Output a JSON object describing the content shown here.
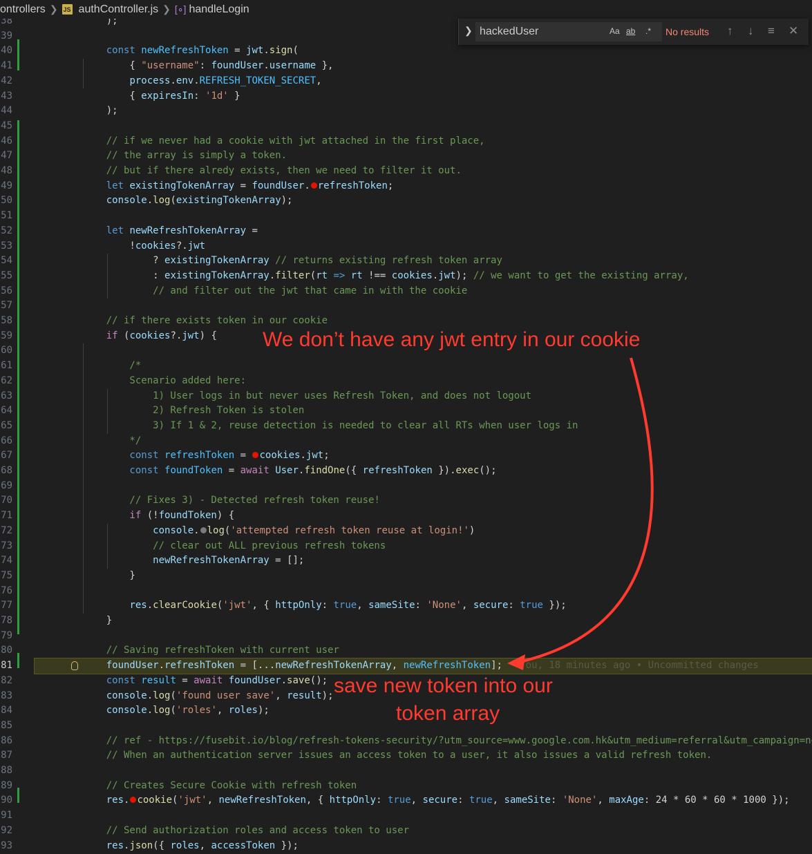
{
  "breadcrumb": {
    "folder": "ontrollers",
    "file": "authController.js",
    "file_icon_label": "JS",
    "symbol": "handleLogin"
  },
  "find_widget": {
    "query": "hackedUser",
    "match_case_label": "Aa",
    "whole_word_label": "ab",
    "regex_label": ".*",
    "status": "No results"
  },
  "editor": {
    "blame": "You, 18 minutes ago • Uncommitted changes",
    "lines": [
      {
        "n": "38",
        "tokens": [
          [
            "plain",
            "    );"
          ]
        ]
      },
      {
        "n": "39",
        "tokens": []
      },
      {
        "n": "40",
        "tokens": [
          [
            "kw",
            "    const "
          ],
          [
            "const",
            "newRefreshToken"
          ],
          [
            "plain",
            " = "
          ],
          [
            "var",
            "jwt"
          ],
          [
            "plain",
            "."
          ],
          [
            "fn",
            "sign"
          ],
          [
            "plain",
            "("
          ]
        ]
      },
      {
        "n": "41",
        "tokens": [
          [
            "plain",
            "        { "
          ],
          [
            "str",
            "\"username\""
          ],
          [
            "plain",
            ": "
          ],
          [
            "var",
            "foundUser"
          ],
          [
            "plain",
            "."
          ],
          [
            "var",
            "username"
          ],
          [
            "plain",
            " },"
          ]
        ]
      },
      {
        "n": "42",
        "tokens": [
          [
            "plain",
            "        "
          ],
          [
            "var",
            "process"
          ],
          [
            "plain",
            "."
          ],
          [
            "var",
            "env"
          ],
          [
            "plain",
            "."
          ],
          [
            "const",
            "REFRESH_TOKEN_SECRET"
          ],
          [
            "plain",
            ","
          ]
        ]
      },
      {
        "n": "43",
        "tokens": [
          [
            "plain",
            "        { "
          ],
          [
            "var",
            "expiresIn"
          ],
          [
            "plain",
            ": "
          ],
          [
            "str",
            "'1d'"
          ],
          [
            "plain",
            " }"
          ]
        ]
      },
      {
        "n": "44",
        "tokens": [
          [
            "plain",
            "    );"
          ]
        ]
      },
      {
        "n": "45",
        "tokens": []
      },
      {
        "n": "46",
        "tokens": [
          [
            "cm",
            "    // if we never had a cookie with jwt attached in the first place,"
          ]
        ]
      },
      {
        "n": "47",
        "tokens": [
          [
            "cm",
            "    // the array is simply a token."
          ]
        ]
      },
      {
        "n": "48",
        "tokens": [
          [
            "cm",
            "    // but if there alredy exists, then we need to filter it out."
          ]
        ]
      },
      {
        "n": "49",
        "tokens": [
          [
            "kw",
            "    let "
          ],
          [
            "var",
            "existingTokenArray"
          ],
          [
            "plain",
            " = "
          ],
          [
            "var",
            "foundUser"
          ],
          [
            "plain",
            "."
          ],
          [
            "bp",
            ""
          ],
          [
            "var",
            "refreshToken"
          ],
          [
            "plain",
            ";"
          ]
        ]
      },
      {
        "n": "50",
        "tokens": [
          [
            "plain",
            "    "
          ],
          [
            "var",
            "console"
          ],
          [
            "plain",
            "."
          ],
          [
            "fn",
            "log"
          ],
          [
            "plain",
            "("
          ],
          [
            "var",
            "existingTokenArray"
          ],
          [
            "plain",
            ");"
          ]
        ]
      },
      {
        "n": "51",
        "tokens": []
      },
      {
        "n": "52",
        "tokens": [
          [
            "kw",
            "    let "
          ],
          [
            "var",
            "newRefreshTokenArray"
          ],
          [
            "plain",
            " ="
          ]
        ]
      },
      {
        "n": "53",
        "tokens": [
          [
            "plain",
            "        !"
          ],
          [
            "var",
            "cookies"
          ],
          [
            "plain",
            "?."
          ],
          [
            "var",
            "jwt"
          ]
        ]
      },
      {
        "n": "54",
        "tokens": [
          [
            "plain",
            "            ? "
          ],
          [
            "var",
            "existingTokenArray"
          ],
          [
            "cm",
            " // returns existing refresh token array"
          ]
        ]
      },
      {
        "n": "55",
        "tokens": [
          [
            "plain",
            "            : "
          ],
          [
            "var",
            "existingTokenArray"
          ],
          [
            "plain",
            "."
          ],
          [
            "fn",
            "filter"
          ],
          [
            "plain",
            "("
          ],
          [
            "var",
            "rt"
          ],
          [
            "kw",
            " => "
          ],
          [
            "var",
            "rt"
          ],
          [
            "plain",
            " !== "
          ],
          [
            "var",
            "cookies"
          ],
          [
            "plain",
            "."
          ],
          [
            "var",
            "jwt"
          ],
          [
            "plain",
            ");"
          ],
          [
            "cm",
            " // we want to get the existing array,"
          ]
        ]
      },
      {
        "n": "56",
        "tokens": [
          [
            "cm",
            "            // and filter out the jwt that came in with the cookie"
          ]
        ]
      },
      {
        "n": "57",
        "tokens": []
      },
      {
        "n": "58",
        "tokens": [
          [
            "cm",
            "    // if there exists token in our cookie"
          ]
        ]
      },
      {
        "n": "59",
        "tokens": [
          [
            "ctl",
            "    if "
          ],
          [
            "plain",
            "("
          ],
          [
            "var",
            "cookies"
          ],
          [
            "plain",
            "?."
          ],
          [
            "var",
            "jwt"
          ],
          [
            "plain",
            ") {"
          ]
        ]
      },
      {
        "n": "60",
        "tokens": []
      },
      {
        "n": "61",
        "tokens": [
          [
            "cm",
            "        /*"
          ]
        ]
      },
      {
        "n": "62",
        "tokens": [
          [
            "cm",
            "        Scenario added here:"
          ]
        ]
      },
      {
        "n": "63",
        "tokens": [
          [
            "cm",
            "            1) User logs in but never uses Refresh Token, and does not logout"
          ]
        ]
      },
      {
        "n": "64",
        "tokens": [
          [
            "cm",
            "            2) Refresh Token is stolen"
          ]
        ]
      },
      {
        "n": "65",
        "tokens": [
          [
            "cm",
            "            3) If 1 & 2, reuse detection is needed to clear all RTs when user logs in"
          ]
        ]
      },
      {
        "n": "66",
        "tokens": [
          [
            "cm",
            "        */"
          ]
        ]
      },
      {
        "n": "67",
        "tokens": [
          [
            "kw",
            "        const "
          ],
          [
            "const",
            "refreshToken"
          ],
          [
            "plain",
            " = "
          ],
          [
            "bp",
            ""
          ],
          [
            "var",
            "cookies"
          ],
          [
            "plain",
            "."
          ],
          [
            "var",
            "jwt"
          ],
          [
            "plain",
            ";"
          ]
        ]
      },
      {
        "n": "68",
        "tokens": [
          [
            "kw",
            "        const "
          ],
          [
            "const",
            "foundToken"
          ],
          [
            "plain",
            " = "
          ],
          [
            "ctl",
            "await "
          ],
          [
            "var",
            "User"
          ],
          [
            "plain",
            "."
          ],
          [
            "fn",
            "findOne"
          ],
          [
            "plain",
            "({ "
          ],
          [
            "var",
            "refreshToken"
          ],
          [
            "plain",
            " })."
          ],
          [
            "fn",
            "exec"
          ],
          [
            "plain",
            "();"
          ]
        ]
      },
      {
        "n": "69",
        "tokens": []
      },
      {
        "n": "70",
        "tokens": [
          [
            "cm",
            "        // Fixes 3) - Detected refresh token reuse!"
          ]
        ]
      },
      {
        "n": "71",
        "tokens": [
          [
            "ctl",
            "        if "
          ],
          [
            "plain",
            "(!"
          ],
          [
            "var",
            "foundToken"
          ],
          [
            "plain",
            ") {"
          ]
        ]
      },
      {
        "n": "72",
        "tokens": [
          [
            "plain",
            "            "
          ],
          [
            "var",
            "console"
          ],
          [
            "plain",
            "."
          ],
          [
            "bpg",
            ""
          ],
          [
            "fn",
            "log"
          ],
          [
            "plain",
            "("
          ],
          [
            "str",
            "'attempted refresh token reuse at login!'"
          ],
          [
            "plain",
            ")"
          ]
        ]
      },
      {
        "n": "73",
        "tokens": [
          [
            "cm",
            "            // clear out ALL previous refresh tokens"
          ]
        ]
      },
      {
        "n": "74",
        "tokens": [
          [
            "plain",
            "            "
          ],
          [
            "var",
            "newRefreshTokenArray"
          ],
          [
            "plain",
            " = [];"
          ]
        ]
      },
      {
        "n": "75",
        "tokens": [
          [
            "plain",
            "        }"
          ]
        ]
      },
      {
        "n": "76",
        "tokens": []
      },
      {
        "n": "77",
        "tokens": [
          [
            "plain",
            "        "
          ],
          [
            "var",
            "res"
          ],
          [
            "plain",
            "."
          ],
          [
            "fn",
            "clearCookie"
          ],
          [
            "plain",
            "("
          ],
          [
            "str",
            "'jwt'"
          ],
          [
            "plain",
            ", { "
          ],
          [
            "var",
            "httpOnly"
          ],
          [
            "plain",
            ": "
          ],
          [
            "kw",
            "true"
          ],
          [
            "plain",
            ", "
          ],
          [
            "var",
            "sameSite"
          ],
          [
            "plain",
            ": "
          ],
          [
            "str",
            "'None'"
          ],
          [
            "plain",
            ", "
          ],
          [
            "var",
            "secure"
          ],
          [
            "plain",
            ": "
          ],
          [
            "kw",
            "true"
          ],
          [
            "plain",
            " });"
          ]
        ]
      },
      {
        "n": "78",
        "tokens": [
          [
            "plain",
            "    }"
          ]
        ]
      },
      {
        "n": "79",
        "tokens": []
      },
      {
        "n": "80",
        "tokens": [
          [
            "cm",
            "    // Saving refreshToken with current user"
          ]
        ]
      },
      {
        "n": "81",
        "tokens": [
          [
            "plain",
            "    "
          ],
          [
            "var",
            "foundUser"
          ],
          [
            "plain",
            "."
          ],
          [
            "var",
            "refreshToken"
          ],
          [
            "plain",
            " = [..."
          ],
          [
            "var",
            "newRefreshTokenArray"
          ],
          [
            "plain",
            ", "
          ],
          [
            "const",
            "newRefreshToken"
          ],
          [
            "plain",
            "];"
          ]
        ]
      },
      {
        "n": "82",
        "tokens": [
          [
            "kw",
            "    const "
          ],
          [
            "const",
            "result"
          ],
          [
            "plain",
            " = "
          ],
          [
            "ctl",
            "await "
          ],
          [
            "var",
            "foundUser"
          ],
          [
            "plain",
            "."
          ],
          [
            "fn",
            "save"
          ],
          [
            "plain",
            "();"
          ]
        ]
      },
      {
        "n": "83",
        "tokens": [
          [
            "plain",
            "    "
          ],
          [
            "var",
            "console"
          ],
          [
            "plain",
            "."
          ],
          [
            "fn",
            "log"
          ],
          [
            "plain",
            "("
          ],
          [
            "str",
            "'found user save'"
          ],
          [
            "plain",
            ", "
          ],
          [
            "var",
            "result"
          ],
          [
            "plain",
            ");"
          ]
        ]
      },
      {
        "n": "84",
        "tokens": [
          [
            "plain",
            "    "
          ],
          [
            "var",
            "console"
          ],
          [
            "plain",
            "."
          ],
          [
            "fn",
            "log"
          ],
          [
            "plain",
            "("
          ],
          [
            "str",
            "'roles'"
          ],
          [
            "plain",
            ", "
          ],
          [
            "var",
            "roles"
          ],
          [
            "plain",
            ");"
          ]
        ]
      },
      {
        "n": "85",
        "tokens": []
      },
      {
        "n": "86",
        "tokens": [
          [
            "cm",
            "    // ref - https://fusebit.io/blog/refresh-tokens-security/?utm_source=www.google.com.hk&utm_medium=referral&utm_campaign=no"
          ]
        ]
      },
      {
        "n": "87",
        "tokens": [
          [
            "cm",
            "    // When an authentication server issues an access token to a user, it also issues a valid refresh token."
          ]
        ]
      },
      {
        "n": "88",
        "tokens": []
      },
      {
        "n": "89",
        "tokens": [
          [
            "cm",
            "    // Creates Secure Cookie with refresh token"
          ]
        ]
      },
      {
        "n": "90",
        "tokens": [
          [
            "plain",
            "    "
          ],
          [
            "var",
            "res"
          ],
          [
            "plain",
            "."
          ],
          [
            "bp",
            ""
          ],
          [
            "fn",
            "cookie"
          ],
          [
            "plain",
            "("
          ],
          [
            "str",
            "'jwt'"
          ],
          [
            "plain",
            ", "
          ],
          [
            "var",
            "newRefreshToken"
          ],
          [
            "plain",
            ", { "
          ],
          [
            "var",
            "httpOnly"
          ],
          [
            "plain",
            ": "
          ],
          [
            "kw",
            "true"
          ],
          [
            "plain",
            ", "
          ],
          [
            "var",
            "secure"
          ],
          [
            "plain",
            ": "
          ],
          [
            "kw",
            "true"
          ],
          [
            "plain",
            ", "
          ],
          [
            "var",
            "sameSite"
          ],
          [
            "plain",
            ": "
          ],
          [
            "str",
            "'None'"
          ],
          [
            "plain",
            ", "
          ],
          [
            "var",
            "maxAge"
          ],
          [
            "plain",
            ": 24 * 60 * 60 * 1000 });"
          ]
        ]
      },
      {
        "n": "91",
        "tokens": []
      },
      {
        "n": "92",
        "tokens": [
          [
            "cm",
            "    // Send authorization roles and access token to user"
          ]
        ]
      },
      {
        "n": "93",
        "tokens": [
          [
            "plain",
            "    "
          ],
          [
            "var",
            "res"
          ],
          [
            "plain",
            "."
          ],
          [
            "fn",
            "json"
          ],
          [
            "plain",
            "({ "
          ],
          [
            "var",
            "roles"
          ],
          [
            "plain",
            ", "
          ],
          [
            "var",
            "accessToken"
          ],
          [
            "plain",
            " });"
          ]
        ]
      }
    ]
  },
  "annotations": {
    "top": "We don’t have any jwt entry in our cookie",
    "bottom_line1": "save new token into our",
    "bottom_line2": "token array",
    "color": "#ff3b2f"
  }
}
